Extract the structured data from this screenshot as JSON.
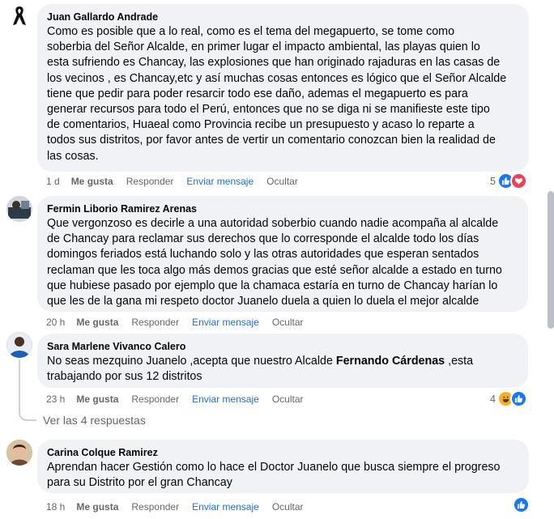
{
  "comments": [
    {
      "author": "Juan Gallardo Andrade",
      "text": "Como es posible que a lo real, como es el tema del megapuerto, se tome como\nsoberbia del Señor Alcalde, en primer lugar el impacto ambiental, las playas quien lo\nesta sufriendo es Chancay, las explosiones que han originado rajaduras en las casas de\nlos vecinos , es Chancay,etc y así muchas cosas entonces es lógico que el Señor Alcalde\ntiene que pedir para poder resarcir todo ese daño, ademas el megapuerto es para\ngenerar recursos para todo el Perú, entonces que no se diga ni se manifieste este tipo\nde comentarios, Huaeal como Provincia recibe un presupuesto y acaso lo reparte a\ntodos sus distritos, por favor antes de vertir un comentario conozcan bien la realidad de\nlas cosas.",
      "time": "1 d",
      "like": "Me gusta",
      "reply": "Responder",
      "message": "Enviar mensaje",
      "hide": "Ocultar",
      "reaction_count": "5",
      "reactions": [
        "like-icon",
        "love-icon"
      ]
    },
    {
      "author": "Fermin Liborio Ramirez Arenas",
      "text": "Que vergonzoso es decirle a una autoridad soberbio cuando nadie acompaña al alcalde\nde Chancay para reclamar sus derechos que lo corresponde el alcalde todo los días\ndomingos feriados está luchando solo y las otras autoridades que esperan sentados\nreclaman que les toca algo más demos gracias que esté señor alcalde a estado en turno\nque hubiese pasado por ejemplo que la chamaca estaría en turno de Chancay harían lo\nque les de la gana mi respeto doctor Juanelo duela a quien lo duela el mejor alcalde",
      "time": "20 h",
      "like": "Me gusta",
      "reply": "Responder",
      "message": "Enviar mensaje",
      "hide": "Ocultar"
    },
    {
      "author": "Sara Marlene Vivanco Calero",
      "text_before": "No seas mezquino Juanelo ,acepta que nuestro Alcalde ",
      "text_bold": "Fernando Cárdenas",
      "text_after": " ,esta\ntrabajando por sus 12 distritos",
      "time": "23 h",
      "like": "Me gusta",
      "reply": "Responder",
      "message": "Enviar mensaje",
      "hide": "Ocultar",
      "reaction_count": "4",
      "reactions": [
        "haha-icon",
        "like-icon"
      ]
    },
    {
      "author": "Carina Colque Ramirez",
      "text": "Aprendan hacer Gestión como lo hace el Doctor Juanelo que busca siempre el progreso\npara su Distrito por el gran Chancay",
      "time": "18 h",
      "like": "Me gusta",
      "reply": "Responder",
      "message": "Enviar mensaje",
      "hide": "Ocultar"
    }
  ],
  "view_replies": "Ver las 4 respuestas",
  "colors": {
    "bubble": "#f0f2f5",
    "link": "#216fdb",
    "meta": "#65676b",
    "like": "#1877f2",
    "love": "#f33e58",
    "haha": "#f7b125"
  }
}
